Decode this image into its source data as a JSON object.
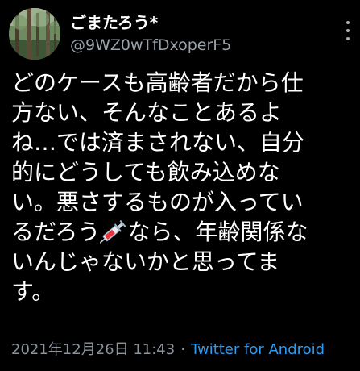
{
  "tweet": {
    "author": {
      "display_name": "ごまたろう*",
      "handle": "@9WZ0wTfDxoperF5",
      "avatar_icon": "forest-avatar"
    },
    "body_lines": [
      "どのケースも高齢者だから仕",
      "方ない、そんなことあるよ",
      "ね…では済まされない、自分",
      "的にどうしても飲み込めな",
      "い。悪さするものが入ってい"
    ],
    "line6_before": "るだろう",
    "emoji_icon": "syringe-icon",
    "line6_after": "なら、年齢関係な",
    "body_lines_end": [
      "いんじゃないかと思ってま",
      "す。"
    ],
    "timestamp": "2021年12月26日 11:43",
    "separator": "·",
    "source": "Twitter for Android",
    "colors": {
      "background": "#000000",
      "text": "#ffffff",
      "secondary": "#8b949c",
      "link": "#2f9bf0"
    }
  }
}
